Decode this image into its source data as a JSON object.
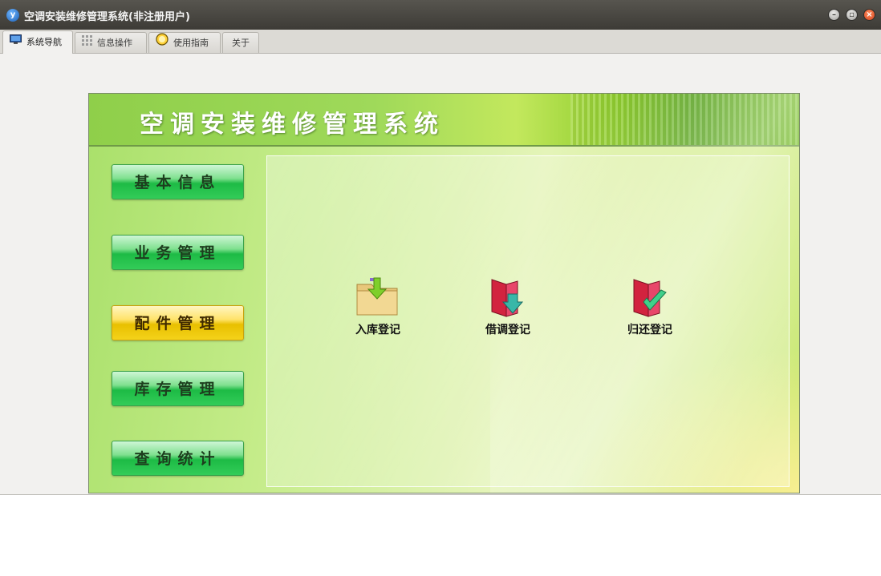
{
  "window": {
    "title": "空调安装维修管理系统(非注册用户)",
    "app_icon": "yf-app-icon",
    "controls": [
      "minimize",
      "maximize",
      "close"
    ]
  },
  "tabs": [
    {
      "label": "系统导航",
      "icon": "monitor-icon",
      "active": true
    },
    {
      "label": "信息操作",
      "icon": "grid-icon",
      "active": false
    },
    {
      "label": "使用指南",
      "icon": "guide-circle-icon",
      "active": false
    },
    {
      "label": "关于",
      "icon": "",
      "active": false
    }
  ],
  "banner": {
    "title": "空调安装维修管理系统"
  },
  "nav": [
    {
      "label": "基本信息",
      "active": false
    },
    {
      "label": "业务管理",
      "active": false
    },
    {
      "label": "配件管理",
      "active": true
    },
    {
      "label": "库存管理",
      "active": false
    },
    {
      "label": "查询统计",
      "active": false
    }
  ],
  "functions": [
    {
      "label": "入库登记",
      "icon": "folder-download-icon"
    },
    {
      "label": "借调登记",
      "icon": "book-arrow-down-icon"
    },
    {
      "label": "归还登记",
      "icon": "book-check-icon"
    }
  ],
  "colors": {
    "titlebar": "#45433e",
    "nav_green": "#1dbb45",
    "nav_active_yellow": "#e8c000",
    "panel_green": "#a9e06a"
  }
}
